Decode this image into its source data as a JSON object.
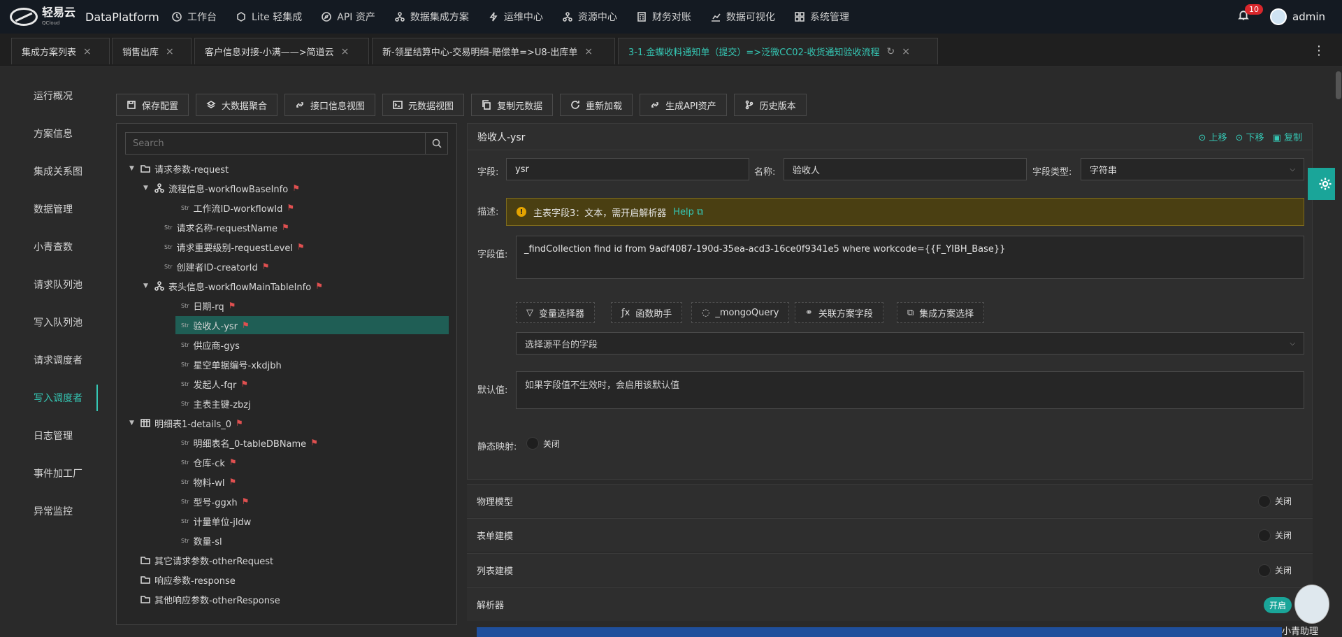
{
  "app": {
    "brand": "轻易云",
    "brand_sub": "QCloud",
    "title": "DataPlatform"
  },
  "nav": [
    "工作台",
    "Lite 轻集成",
    "API 资产",
    "数据集成方案",
    "运维中心",
    "资源中心",
    "财务对账",
    "数据可视化",
    "系统管理"
  ],
  "notifications": {
    "count": "10"
  },
  "user": {
    "name": "admin"
  },
  "tabs": [
    "集成方案列表",
    "销售出库",
    "客户信息对接-小满——>简道云",
    "新-领星结算中心-交易明细-赔偿单=>U8-出库单",
    "3-1.金蝶收料通知单（提交）=>泛微CC02-收货通知验收流程"
  ],
  "sidebar": [
    "运行概况",
    "方案信息",
    "集成关系图",
    "数据管理",
    "小青查数",
    "请求队列池",
    "写入队列池",
    "请求调度者",
    "写入调度者",
    "日志管理",
    "事件加工厂",
    "异常监控"
  ],
  "toolbar": [
    "保存配置",
    "大数据聚合",
    "接口信息视图",
    "元数据视图",
    "复制元数据",
    "重新加载",
    "生成API资产",
    "历史版本"
  ],
  "search": {
    "placeholder": "Search"
  },
  "tree": [
    {
      "label": "请求参数-request"
    },
    {
      "label": "流程信息-workflowBaseInfo"
    },
    {
      "label": "工作流ID-workflowId"
    },
    {
      "label": "请求名称-requestName"
    },
    {
      "label": "请求重要级别-requestLevel"
    },
    {
      "label": "创建者ID-creatorId"
    },
    {
      "label": "表头信息-workflowMainTableInfo"
    },
    {
      "label": "日期-rq"
    },
    {
      "label": "验收人-ysr"
    },
    {
      "label": "供应商-gys"
    },
    {
      "label": "星空单据编号-xkdjbh"
    },
    {
      "label": "发起人-fqr"
    },
    {
      "label": "主表主键-zbzj"
    },
    {
      "label": "明细表1-details_0"
    },
    {
      "label": "明细表名_0-tableDBName"
    },
    {
      "label": "仓库-ck"
    },
    {
      "label": "物料-wl"
    },
    {
      "label": "型号-ggxh"
    },
    {
      "label": "计量单位-jldw"
    },
    {
      "label": "数量-sl"
    },
    {
      "label": "其它请求参数-otherRequest"
    },
    {
      "label": "响应参数-response"
    },
    {
      "label": "其他响应参数-otherResponse"
    }
  ],
  "str_tag": "Str",
  "detail": {
    "header": "验收人-ysr",
    "up": "上移",
    "down": "下移",
    "copy": "复制",
    "field_label": "字段:",
    "field_value": "ysr",
    "name_label": "名称:",
    "name_value": "验收人",
    "type_label": "字段类型:",
    "type_value": "字符串",
    "desc_label": "描述:",
    "desc_text": "主表字段3：文本，需开启解析器",
    "help": "Help",
    "value_label": "字段值:",
    "value_text": "_findCollection find id from 9adf4087-190d-35ea-acd3-16ce0f9341e5 where workcode={{F_YIBH_Base}}",
    "helpers": [
      "变量选择器",
      "函数助手",
      "_mongoQuery",
      "关联方案字段",
      "集成方案选择"
    ],
    "source_placeholder": "选择源平台的字段",
    "default_label": "默认值:",
    "default_placeholder": "如果字段值不生效时，会启用该默认值",
    "static_label": "静态映射:",
    "off": "关闭"
  },
  "sections": [
    "物理模型",
    "表单建模",
    "列表建模",
    "解析器"
  ],
  "assistant": {
    "bubble": "开启",
    "name": "小青助理"
  }
}
